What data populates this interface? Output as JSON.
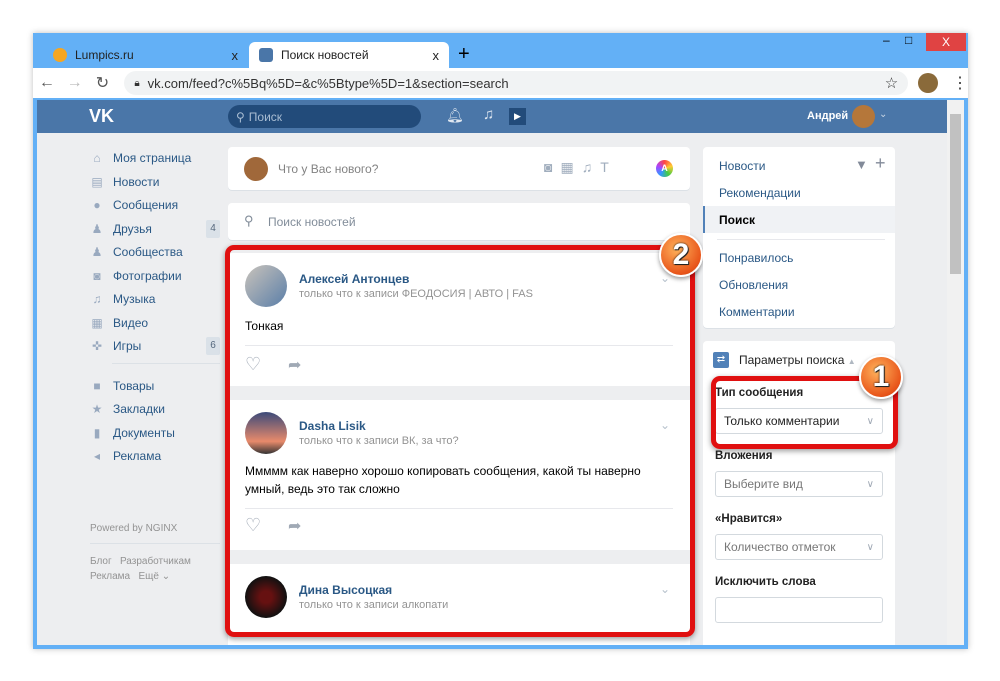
{
  "browser": {
    "tabs": [
      {
        "label": "Lumpics.ru",
        "close": "x"
      },
      {
        "label": "Поиск новостей",
        "close": "x"
      }
    ],
    "new_tab": "+",
    "url": "vk.com/feed?c%5Bq%5D=&c%5Btype%5D=1&section=search",
    "window_buttons": {
      "min": "–",
      "max": "□",
      "close": "X"
    }
  },
  "header": {
    "logo": "VK",
    "search_placeholder": "Поиск",
    "user": "Андрей"
  },
  "sidebar": {
    "items": [
      {
        "label": "Моя страница",
        "icon": "home-icon",
        "glyph": "⌂"
      },
      {
        "label": "Новости",
        "icon": "news-icon",
        "glyph": "▤"
      },
      {
        "label": "Сообщения",
        "icon": "messages-icon",
        "glyph": "●"
      },
      {
        "label": "Друзья",
        "icon": "friends-icon",
        "glyph": "♟",
        "count": "4"
      },
      {
        "label": "Сообщества",
        "icon": "communities-icon",
        "glyph": "♟"
      },
      {
        "label": "Фотографии",
        "icon": "camera-icon",
        "glyph": "◙"
      },
      {
        "label": "Музыка",
        "icon": "music-icon",
        "glyph": "♫"
      },
      {
        "label": "Видео",
        "icon": "video-icon",
        "glyph": "▦"
      },
      {
        "label": "Игры",
        "icon": "games-icon",
        "glyph": "✜",
        "count": "6"
      },
      {
        "label": "Товары",
        "icon": "bag-icon",
        "glyph": "■"
      },
      {
        "label": "Закладки",
        "icon": "star-icon",
        "glyph": "★"
      },
      {
        "label": "Документы",
        "icon": "document-icon",
        "glyph": "▮"
      },
      {
        "label": "Реклама",
        "icon": "megaphone-icon",
        "glyph": "◂"
      }
    ],
    "powered": "Powered by NGINX",
    "footer": [
      "Блог",
      "Разработчикам",
      "Реклама",
      "Ещё ⌄"
    ]
  },
  "composer": {
    "placeholder": "Что у Вас нового?"
  },
  "news_search": {
    "placeholder": "Поиск новостей"
  },
  "posts": [
    {
      "author": "Алексей Антонцев",
      "sub": "только что к записи ФЕОДОСИЯ | АВТО | FAS",
      "text": "Тонкая"
    },
    {
      "author": "Dasha Lisik",
      "sub": "только что к записи ВК, за что?",
      "text": "Ммммм как наверно хорошо копировать сообщения, какой ты наверно умный, ведь это так сложно"
    },
    {
      "author": "Дина Высоцкая",
      "sub": "только что к записи алкопати",
      "text": ""
    }
  ],
  "right_menu": {
    "items": [
      "Новости",
      "Рекомендации",
      "Поиск",
      "Понравилось",
      "Обновления",
      "Комментарии"
    ],
    "active": "Поиск"
  },
  "params": {
    "title": "Параметры поиска",
    "type_label": "Тип сообщения",
    "type_value": "Только комментарии",
    "attach_label": "Вложения",
    "attach_value": "Выберите вид",
    "likes_label": "«Нравится»",
    "likes_value": "Количество отметок",
    "exclude_label": "Исключить слова",
    "exclude_value": ""
  },
  "annotations": [
    "1",
    "2"
  ],
  "colors": {
    "vk_header": "#4a76a8",
    "link": "#2a5885",
    "highlight": "#e01010"
  }
}
